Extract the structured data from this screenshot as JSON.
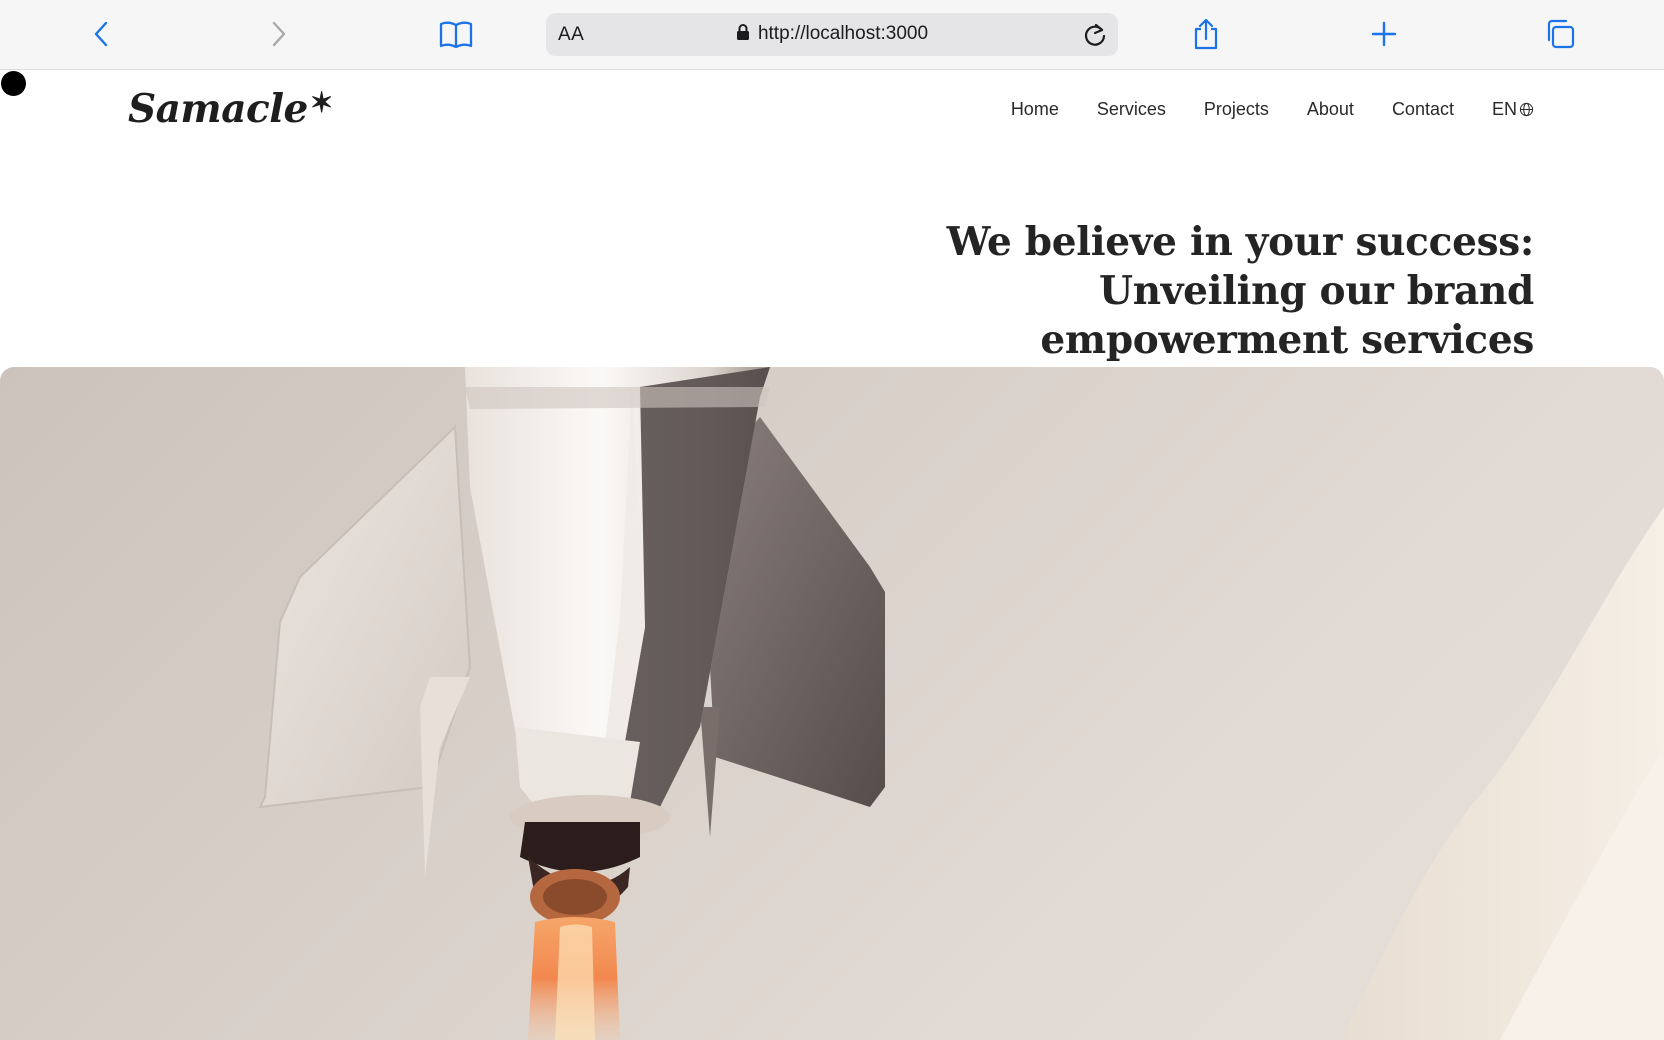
{
  "browser": {
    "address_bar": {
      "text_size_label": "AA",
      "url": "http://localhost:3000"
    },
    "icons": {
      "back": "chevron-left-icon",
      "forward": "chevron-right-icon",
      "bookmarks": "book-icon",
      "lock": "lock-icon",
      "reload": "reload-icon",
      "share": "share-icon",
      "new_tab": "plus-icon",
      "tabs": "tabs-icon"
    },
    "accent_color": "#1a73e8"
  },
  "site": {
    "logo": "Samacle",
    "logo_mark": "✶",
    "nav": {
      "items": [
        {
          "label": "Home"
        },
        {
          "label": "Services"
        },
        {
          "label": "Projects"
        },
        {
          "label": "About"
        },
        {
          "label": "Contact"
        }
      ],
      "language": "EN",
      "language_icon": "globe-icon"
    },
    "hero": {
      "title_lines": [
        "We believe in your success:",
        "Unveiling our brand",
        "empowerment services"
      ],
      "image": "rocket-launch-image"
    }
  }
}
